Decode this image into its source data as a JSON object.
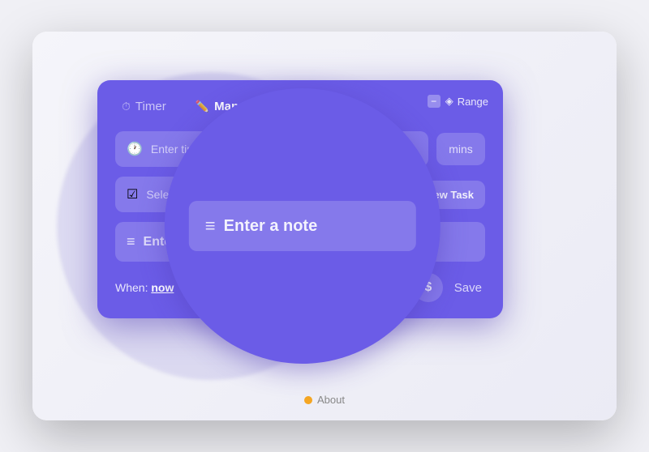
{
  "tabs": [
    {
      "id": "timer",
      "label": "Timer",
      "icon": "⏱"
    },
    {
      "id": "manual",
      "label": "Manual",
      "icon": "✏️",
      "active": true
    }
  ],
  "range_button": "Range",
  "minimize_label": "−",
  "fields": {
    "time_placeholder": "Enter time e.g. 3 hours 20 m",
    "mins_label": "mins",
    "task_placeholder": "Select task...",
    "new_task_label": "+ New Task",
    "note_placeholder": "Enter a note"
  },
  "bottom": {
    "when_label": "When:",
    "when_value": "now",
    "save_label": "Save"
  },
  "about_label": "About"
}
